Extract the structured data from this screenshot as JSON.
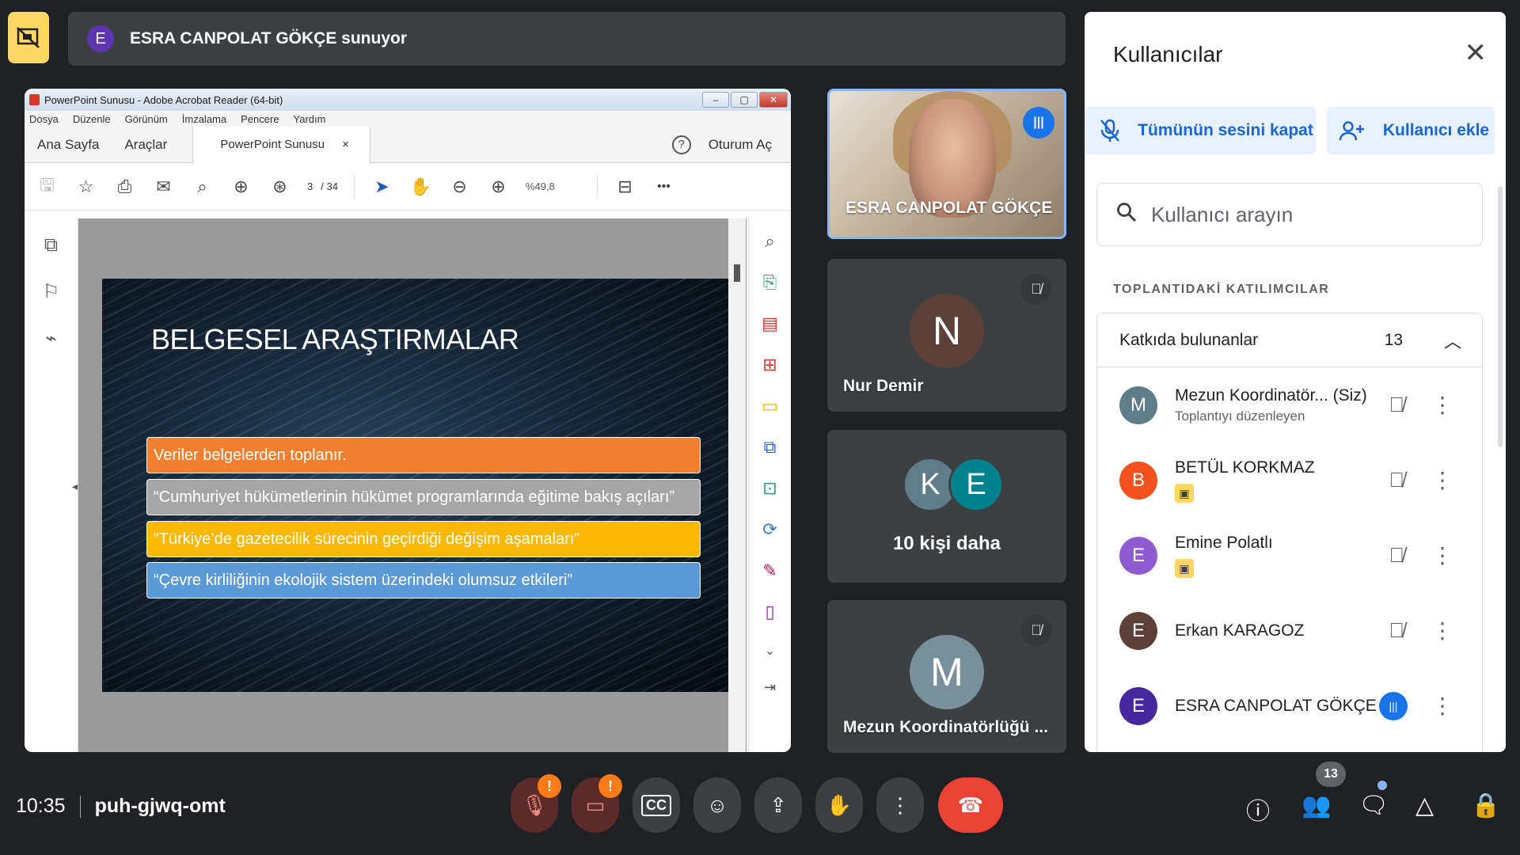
{
  "presenting": {
    "avatar_letter": "E",
    "label": "ESRA CANPOLAT GÖKÇE sunuyor"
  },
  "acrobat": {
    "window_title": "PowerPoint Sunusu - Adobe Acrobat Reader (64-bit)",
    "menu": [
      "Dosya",
      "Düzenle",
      "Görünüm",
      "İmzalama",
      "Pencere",
      "Yardım"
    ],
    "tabs": {
      "home": "Ana Sayfa",
      "tools": "Araçlar",
      "doc": "PowerPoint Sunusu",
      "doc_close": "×"
    },
    "help": "?",
    "sign_in": "Oturum Aç",
    "page_current": "3",
    "page_total": "/ 34",
    "zoom": "%49,8",
    "more": "•••"
  },
  "slide": {
    "title": "BELGESEL ARAŞTIRMALAR",
    "bullets": [
      "Veriler belgelerden toplanır.",
      "“Cumhuriyet hükümetlerinin hükümet programlarında eğitime bakış açıları”",
      "“Türkiye’de gazetecilik sürecinin geçirdiği değişim aşamaları”",
      "“Çevre kirliliğinin ekolojik sistem üzerindeki olumsuz etkileri”"
    ],
    "colors": [
      "#f07f30",
      "#a6a6a6",
      "#fdb803",
      "#5b9ad9"
    ]
  },
  "tiles": {
    "speaker": {
      "name": "ESRA CANPOLAT GÖKÇE"
    },
    "nur": {
      "letter": "N",
      "name": "Nur Demir",
      "color": "#5d4037"
    },
    "more": {
      "letters": [
        "K",
        "E"
      ],
      "label": "10 kişi daha"
    },
    "mezun": {
      "letter": "M",
      "name": "Mezun Koordinatörlüğü ..."
    }
  },
  "panel": {
    "title": "Kullanıcılar",
    "mute_all": "Tümünün sesini kapat",
    "add_user": "Kullanıcı ekle",
    "search_placeholder": "Kullanıcı arayın",
    "section": "TOPLANTIDAKİ KATILIMCILAR",
    "contributors_label": "Katkıda bulunanlar",
    "contributors_count": "13",
    "participants": [
      {
        "letter": "M",
        "name": "Mezun Koordinatör... (Siz)",
        "sub": "Toplantıyı düzenleyen",
        "color": "#5f7c8a"
      },
      {
        "letter": "B",
        "name": "BETÜL KORKMAZ",
        "color": "#f4511e"
      },
      {
        "letter": "E",
        "name": "Emine Polatlı",
        "color": "#8e5bd0"
      },
      {
        "letter": "E",
        "name": "Erkan KARAGOZ",
        "color": "#5d4037"
      },
      {
        "letter": "E",
        "name": "ESRA CANPOLAT GÖKÇE",
        "color": "#4527a0"
      }
    ]
  },
  "bottom": {
    "time": "10:35",
    "meeting_code": "puh-gjwq-omt",
    "people_count": "13"
  }
}
